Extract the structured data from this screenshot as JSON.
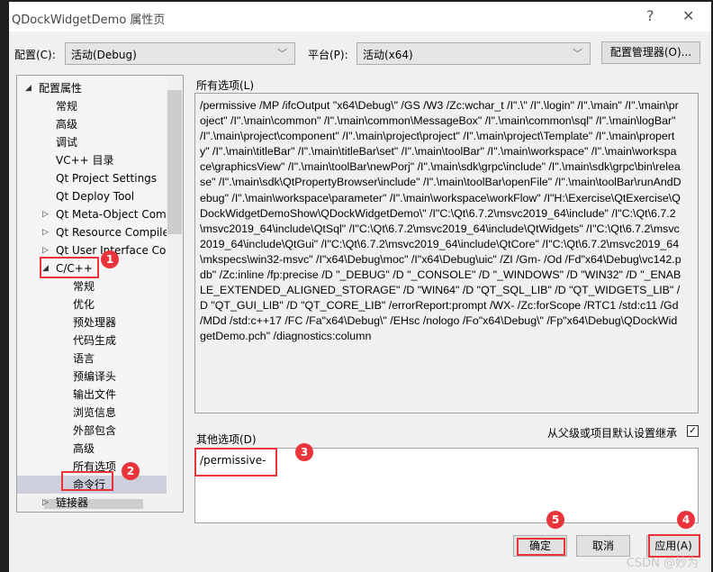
{
  "window": {
    "title": "QDockWidgetDemo 属性页",
    "help": "?",
    "close": "✕"
  },
  "config": {
    "label": "配置(C):",
    "value": "活动(Debug)",
    "platform_label": "平台(P):",
    "platform_value": "活动(x64)",
    "manager_button": "配置管理器(O)..."
  },
  "tree": {
    "items": [
      {
        "label": "配置属性",
        "level": 0,
        "expander": "expanded"
      },
      {
        "label": "常规",
        "level": 1
      },
      {
        "label": "高级",
        "level": 1
      },
      {
        "label": "调试",
        "level": 1
      },
      {
        "label": "VC++ 目录",
        "level": 1
      },
      {
        "label": "Qt Project Settings",
        "level": 1
      },
      {
        "label": "Qt Deploy Tool",
        "level": 1
      },
      {
        "label": "Qt Meta-Object Compiler",
        "level": 1,
        "expander": "collapsed"
      },
      {
        "label": "Qt Resource Compiler",
        "level": 1,
        "expander": "collapsed"
      },
      {
        "label": "Qt User Interface Compiler",
        "level": 1,
        "expander": "collapsed"
      },
      {
        "label": "C/C++",
        "level": 1,
        "expander": "expanded"
      },
      {
        "label": "常规",
        "level": 2
      },
      {
        "label": "优化",
        "level": 2
      },
      {
        "label": "预处理器",
        "level": 2
      },
      {
        "label": "代码生成",
        "level": 2
      },
      {
        "label": "语言",
        "level": 2
      },
      {
        "label": "预编译头",
        "level": 2
      },
      {
        "label": "输出文件",
        "level": 2
      },
      {
        "label": "浏览信息",
        "level": 2
      },
      {
        "label": "外部包含",
        "level": 2
      },
      {
        "label": "高级",
        "level": 2
      },
      {
        "label": "所有选项",
        "level": 2
      },
      {
        "label": "命令行",
        "level": 2,
        "selected": true
      },
      {
        "label": "链接器",
        "level": 1,
        "expander": "collapsed"
      }
    ]
  },
  "all_options": {
    "label": "所有选项(L)",
    "value": "/permissive /MP /ifcOutput \"x64\\Debug\\\" /GS /W3 /Zc:wchar_t /I\".\\\" /I\".\\login\" /I\".\\main\" /I\".\\main\\project\" /I\".\\main\\common\" /I\".\\main\\common\\MessageBox\" /I\".\\main\\common\\sql\" /I\".\\main\\logBar\" /I\".\\main\\project\\component\" /I\".\\main\\project\\project\" /I\".\\main\\project\\Template\" /I\".\\main\\property\" /I\".\\main\\titleBar\" /I\".\\main\\titleBar\\set\" /I\".\\main\\toolBar\" /I\".\\main\\workspace\" /I\".\\main\\workspace\\graphicsView\" /I\".\\main\\toolBar\\newPorj\" /I\".\\main\\sdk\\grpc\\include\" /I\".\\main\\sdk\\grpc\\bin\\release\" /I\".\\main\\sdk\\QtPropertyBrowser\\include\" /I\".\\main\\toolBar\\openFile\" /I\".\\main\\toolBar\\runAndDebug\" /I\".\\main\\workspace\\parameter\" /I\".\\main\\workspace\\workFlow\" /I\"H:\\Exercise\\QtExercise\\QDockWidgetDemoShow\\QDockWidgetDemo\\\" /I\"C:\\Qt\\6.7.2\\msvc2019_64\\include\" /I\"C:\\Qt\\6.7.2\\msvc2019_64\\include\\QtSql\" /I\"C:\\Qt\\6.7.2\\msvc2019_64\\include\\QtWidgets\" /I\"C:\\Qt\\6.7.2\\msvc2019_64\\include\\QtGui\" /I\"C:\\Qt\\6.7.2\\msvc2019_64\\include\\QtCore\" /I\"C:\\Qt\\6.7.2\\msvc2019_64\\mkspecs\\win32-msvc\" /I\"x64\\Debug\\moc\" /I\"x64\\Debug\\uic\" /ZI /Gm- /Od /Fd\"x64\\Debug\\vc142.pdb\" /Zc:inline /fp:precise /D \"_DEBUG\" /D \"_CONSOLE\" /D \"_WINDOWS\" /D \"WIN32\" /D \"_ENABLE_EXTENDED_ALIGNED_STORAGE\" /D \"WIN64\" /D \"QT_SQL_LIB\" /D \"QT_WIDGETS_LIB\" /D \"QT_GUI_LIB\" /D \"QT_CORE_LIB\" /errorReport:prompt /WX- /Zc:forScope /RTC1 /std:c11 /Gd /MDd /std:c++17 /FC /Fa\"x64\\Debug\\\" /EHsc /nologo /Fo\"x64\\Debug\\\" /Fp\"x64\\Debug\\QDockWidgetDemo.pch\" /diagnostics:column"
  },
  "other_options": {
    "label": "其他选项(D)",
    "value": "/permissive-",
    "inherit_label": "从父级或项目默认设置继承",
    "inherit_checked": true
  },
  "buttons": {
    "ok": "确定",
    "cancel": "取消",
    "apply": "应用(A)"
  },
  "annotations": [
    "1",
    "2",
    "3",
    "4",
    "5"
  ],
  "watermark": "CSDN @妙为",
  "colors": {
    "annotation": "#e8343a",
    "selection": "#cdd0dc"
  }
}
